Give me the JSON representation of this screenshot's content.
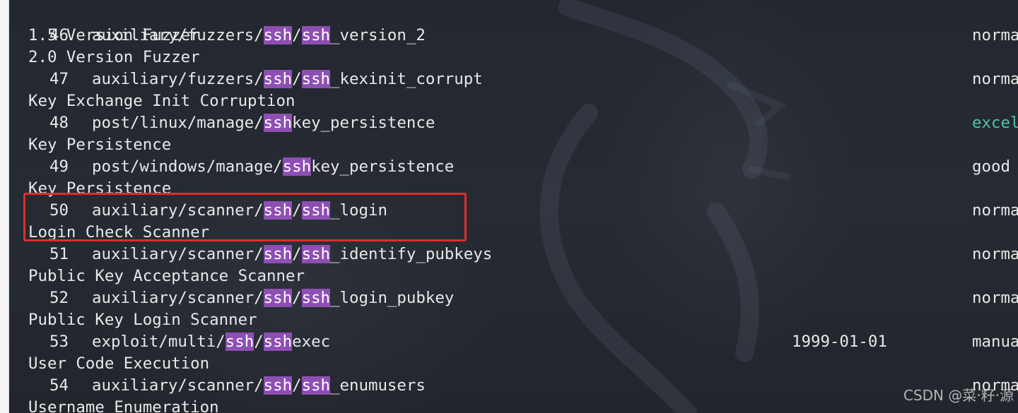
{
  "colors": {
    "background": "#23272f",
    "text": "#e8e8e8",
    "highlight_bg": "#8e4fb4",
    "rank_excellent": "#4fc3a9",
    "select_box": "#e02c2c"
  },
  "top_partial_line": "1.5 Version Fuzzer",
  "rows": [
    {
      "num": "46",
      "p1": "auxiliary/fuzzers/",
      "h1": "ssh",
      "p2": "/",
      "h2": "ssh",
      "p3": "_version_2",
      "date": "",
      "rank": "norma",
      "rank_class": "normal",
      "desc": "2.0 Version Fuzzer"
    },
    {
      "num": "47",
      "p1": "auxiliary/fuzzers/",
      "h1": "ssh",
      "p2": "/",
      "h2": "ssh",
      "p3": "_kexinit_corrupt",
      "date": "",
      "rank": "norma",
      "rank_class": "normal",
      "desc": "Key Exchange Init Corruption"
    },
    {
      "num": "48",
      "p1": "post/linux/manage/",
      "h1": "ssh",
      "p2": "key_persistence",
      "h2": "",
      "p3": "",
      "date": "",
      "rank": "excel",
      "rank_class": "excellent",
      "desc": "Key Persistence"
    },
    {
      "num": "49",
      "p1": "post/windows/manage/",
      "h1": "ssh",
      "p2": "key_persistence",
      "h2": "",
      "p3": "",
      "date": "",
      "rank": "good",
      "rank_class": "good",
      "desc": "Key Persistence"
    },
    {
      "num": "50",
      "p1": "auxiliary/scanner/",
      "h1": "ssh",
      "p2": "/",
      "h2": "ssh",
      "p3": "_login",
      "date": "",
      "rank": "norma",
      "rank_class": "normal",
      "desc": "Login Check Scanner"
    },
    {
      "num": "51",
      "p1": "auxiliary/scanner/",
      "h1": "ssh",
      "p2": "/",
      "h2": "ssh",
      "p3": "_identify_pubkeys",
      "date": "",
      "rank": "norma",
      "rank_class": "normal",
      "desc": "Public Key Acceptance Scanner"
    },
    {
      "num": "52",
      "p1": "auxiliary/scanner/",
      "h1": "ssh",
      "p2": "/",
      "h2": "ssh",
      "p3": "_login_pubkey",
      "date": "",
      "rank": "norma",
      "rank_class": "normal",
      "desc": "Public Key Login Scanner"
    },
    {
      "num": "53",
      "p1": "exploit/multi/",
      "h1": "ssh",
      "p2": "/",
      "h2": "ssh",
      "p3": "exec",
      "date": "1999-01-01",
      "rank": "manua",
      "rank_class": "normal",
      "desc": "User Code Execution"
    },
    {
      "num": "54",
      "p1": "auxiliary/scanner/",
      "h1": "ssh",
      "p2": "/",
      "h2": "ssh",
      "p3": "_enumusers",
      "date": "",
      "rank": "norma",
      "rank_class": "normal",
      "desc": "Username Enumeration"
    }
  ],
  "watermark": "CSDN @菜·籽·源"
}
